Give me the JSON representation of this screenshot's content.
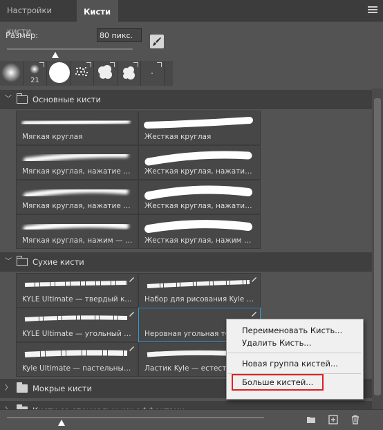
{
  "tabs": [
    {
      "label": "Настройки кисти",
      "active": false
    },
    {
      "label": "Кисти",
      "active": true
    }
  ],
  "size": {
    "label": "Размер:",
    "value": "80 пикс."
  },
  "recent_brushes": [
    {
      "label": ""
    },
    {
      "label": "21"
    },
    {
      "label": ""
    },
    {
      "label": ""
    },
    {
      "label": ""
    },
    {
      "label": ""
    },
    {
      "label": ""
    }
  ],
  "groups": [
    {
      "name": "Основные кисти",
      "expanded": true,
      "brushes": [
        {
          "name": "Мягкая круглая"
        },
        {
          "name": "Жесткая круглая"
        },
        {
          "name": "Мягкая круглая, нажатие = р..."
        },
        {
          "name": "Жесткая круглая, нажатие = ..."
        },
        {
          "name": "Мягкая круглая, нажатие = н..."
        },
        {
          "name": "Жесткая круглая, нажатие = н..."
        },
        {
          "name": "Мягкая круглая, нажим — ма..."
        },
        {
          "name": "Жесткая круглая, нажим — ма..."
        }
      ]
    },
    {
      "name": "Сухие кисти",
      "expanded": true,
      "brushes": [
        {
          "name": "KYLE Ultimate — твердый кар..."
        },
        {
          "name": "Набор для рисования Kyle —..."
        },
        {
          "name": "KYLE Ultimate — угольный ка..."
        },
        {
          "name": "Неровная угольная тек..."
        },
        {
          "name": "Kyle Ultimate — пастельные к..."
        },
        {
          "name": "Ластик Kyle — естеств..."
        }
      ]
    },
    {
      "name": "Мокрые кисти",
      "expanded": false
    },
    {
      "name": "Кисти со специальными эффектами",
      "expanded": false
    }
  ],
  "context_menu": {
    "items": [
      "Переименовать Кисть...",
      "Удалить Кисть...",
      "Новая группа кистей...",
      "Больше кистей..."
    ],
    "highlighted": "Больше кистей...",
    "highlight_color": "#e02020"
  },
  "icons": {
    "panel_menu": "menu-icon",
    "new_preset": "brush-preset-icon",
    "folder": "folder-icon",
    "new_brush": "new-brush-icon",
    "delete": "trash-icon"
  },
  "colors": {
    "panel_bg": "#535353",
    "tab_bg": "#3c3c3c",
    "selection_border": "#3a9ad9"
  }
}
